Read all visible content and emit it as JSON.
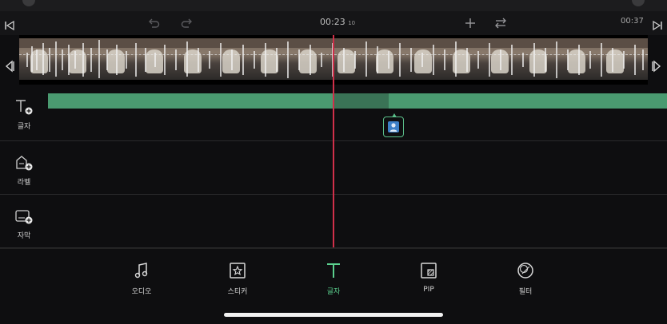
{
  "header": {
    "current_time": "00:23",
    "current_time_frame": "10",
    "total_time": "00:37"
  },
  "tracks": [
    {
      "label": "글자",
      "icon": "text-add-icon"
    },
    {
      "label": "라벨",
      "icon": "label-add-icon"
    },
    {
      "label": "자막",
      "icon": "subtitle-add-icon"
    }
  ],
  "toolbar": {
    "items": [
      {
        "label": "오디오",
        "icon": "music-note-icon"
      },
      {
        "label": "스티커",
        "icon": "sticker-icon"
      },
      {
        "label": "글자",
        "icon": "text-icon"
      },
      {
        "label": "PIP",
        "icon": "pip-icon"
      },
      {
        "label": "필터",
        "icon": "filter-icon"
      }
    ],
    "active_index": 2
  },
  "colors": {
    "accent": "#5bd08e",
    "playhead": "#d0304a",
    "text_track": "#4a9a70"
  }
}
